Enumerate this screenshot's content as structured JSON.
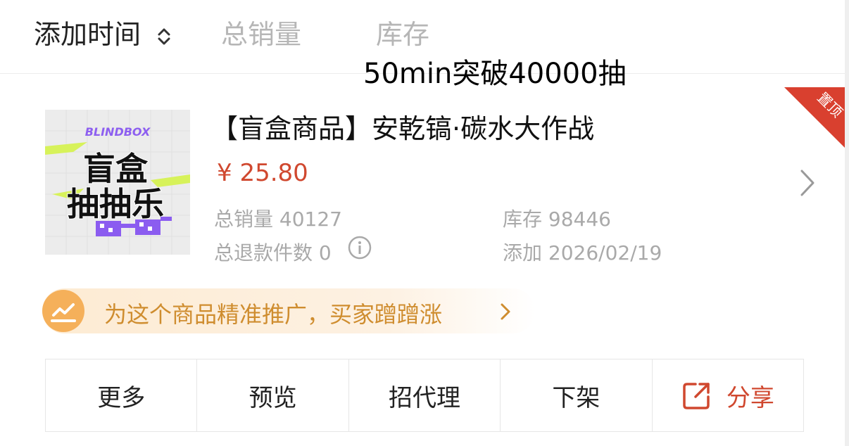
{
  "sort_bar": {
    "items": [
      {
        "label": "添加时间",
        "active": true
      },
      {
        "label": "总销量",
        "active": false
      },
      {
        "label": "库存",
        "active": false
      }
    ]
  },
  "caption": "50min突破40000抽",
  "pin_badge": "置顶",
  "product": {
    "thumbnail": {
      "brand": "BLINDBOX",
      "line1": "盲盒",
      "line2": "抽抽乐"
    },
    "title": "【盲盒商品】安乾镐·碳水大作战",
    "price": "¥ 25.80",
    "total_sales": "总销量 40127",
    "stock": "库存 98446",
    "refunds": "总退款件数 0",
    "added": "添加 2026/02/19"
  },
  "promo": {
    "text": "为这个商品精准推广，买家蹭蹭涨"
  },
  "actions": {
    "more": "更多",
    "preview": "预览",
    "recruit_agent": "招代理",
    "delist": "下架",
    "share": "分享"
  },
  "colors": {
    "price": "#d0482f",
    "pin_ribbon": "#d9402f",
    "promo_text": "#cf8d2f",
    "promo_bg": "#fdebd3",
    "promo_icon_bg": "#f5b05a",
    "share": "#d0482f"
  },
  "icons": {
    "sort_indicator": "chevron-up-down-icon",
    "product_arrow": "chevron-right-icon",
    "refund_info": "info-icon",
    "promo": "trend-chart-icon",
    "share": "share-out-icon"
  }
}
